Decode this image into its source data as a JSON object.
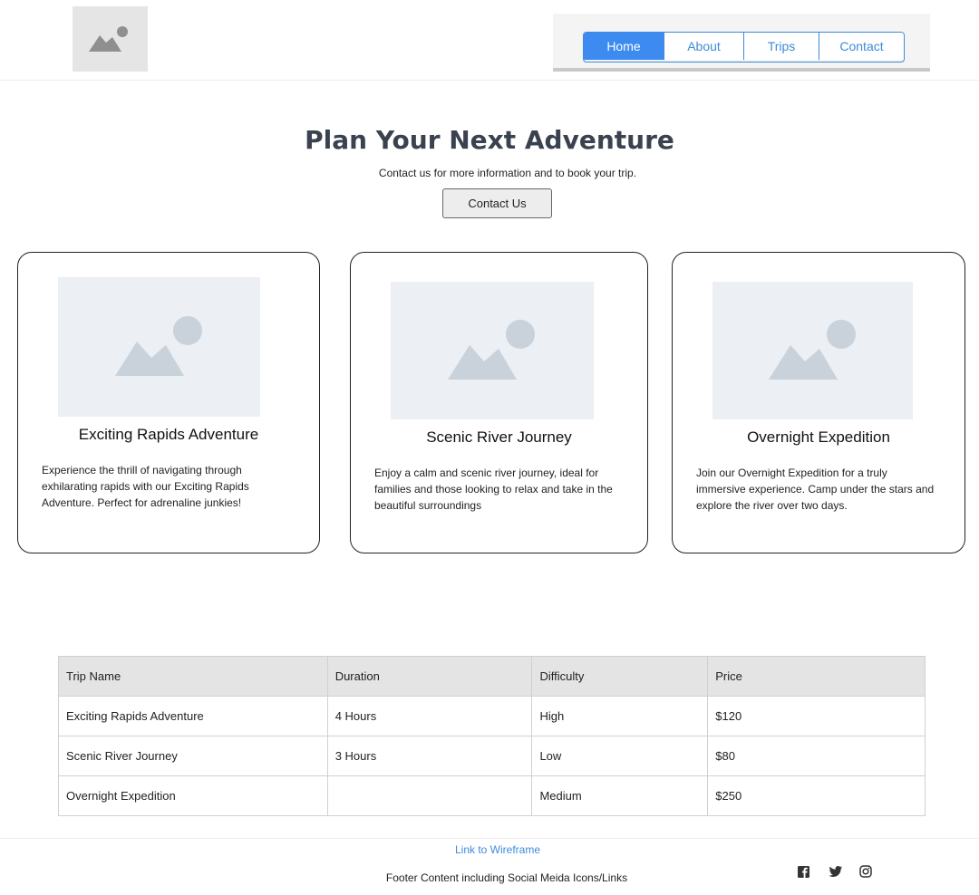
{
  "header": {
    "logo_icon": "image-placeholder-icon",
    "nav": [
      {
        "label": "Home",
        "active": true
      },
      {
        "label": "About",
        "active": false
      },
      {
        "label": "Trips",
        "active": false
      },
      {
        "label": "Contact",
        "active": false
      }
    ]
  },
  "hero": {
    "title": "Plan Your Next Adventure",
    "subtitle": "Contact us for more information and to book your trip.",
    "button_label": "Contact Us"
  },
  "cards": [
    {
      "title": "Exciting Rapids Adventure",
      "description": "Experience the thrill of navigating through exhilarating rapids with our Exciting Rapids Adventure. Perfect for adrenaline junkies!",
      "image_icon": "image-placeholder-icon"
    },
    {
      "title": "Scenic River Journey",
      "description": "Enjoy a calm and scenic river journey, ideal for families and those looking to relax and take in the beautiful surroundings",
      "image_icon": "image-placeholder-icon"
    },
    {
      "title": "Overnight Expedition",
      "description": "Join our Overnight Expedition for a truly immersive experience. Camp under the stars and explore the river over two days.",
      "image_icon": "image-placeholder-icon"
    }
  ],
  "table": {
    "headers": [
      "Trip Name",
      "Duration",
      "Difficulty",
      "Price"
    ],
    "rows": [
      [
        "Exciting Rapids Adventure",
        "4 Hours",
        "High",
        "$120"
      ],
      [
        "Scenic River Journey",
        "3 Hours",
        "Low",
        "$80"
      ],
      [
        "Overnight Expedition",
        "",
        "Medium",
        "$250"
      ]
    ]
  },
  "footer": {
    "link_label": "Link to Wireframe",
    "text": "Footer Content including Social Meida Icons/Links",
    "social_icons": [
      "facebook-icon",
      "twitter-icon",
      "instagram-icon"
    ]
  },
  "colors": {
    "accent": "#3d8bd9",
    "nav_active": "#3d8bf0",
    "title": "#3a4250",
    "placeholder": "#c9d1da"
  }
}
